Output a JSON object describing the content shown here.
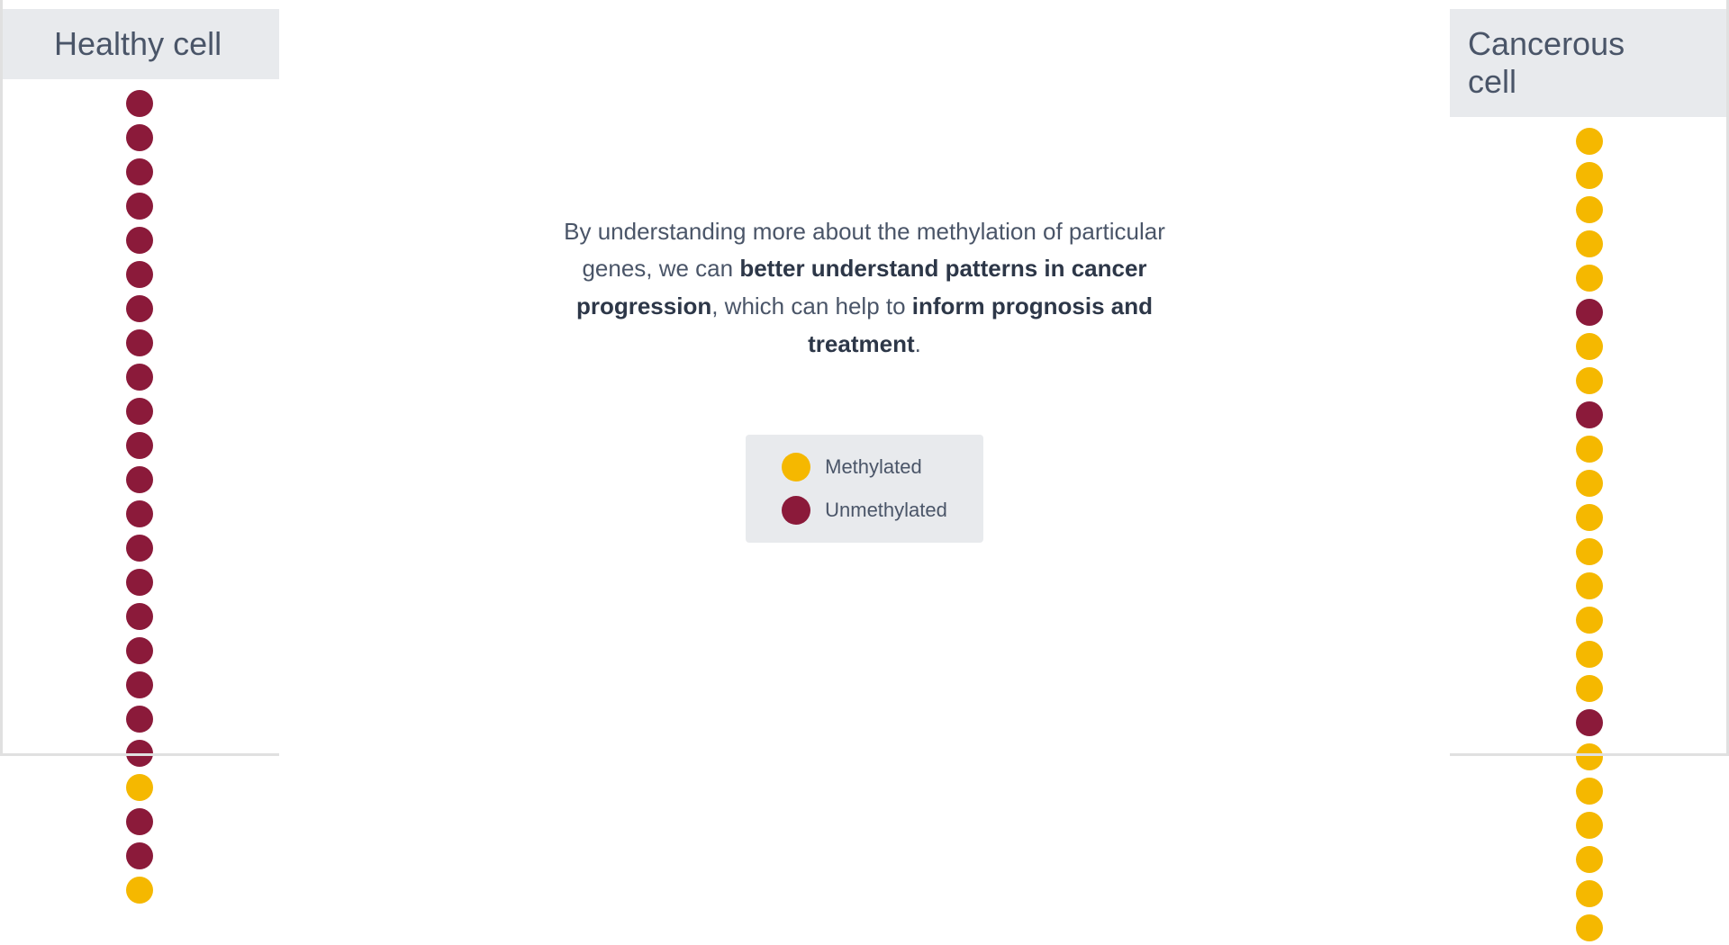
{
  "left": {
    "header": "Healthy cell",
    "dots": [
      "dark-red",
      "dark-red",
      "dark-red",
      "dark-red",
      "dark-red",
      "dark-red",
      "dark-red",
      "dark-red",
      "dark-red",
      "dark-red",
      "dark-red",
      "dark-red",
      "dark-red",
      "dark-red",
      "dark-red",
      "dark-red",
      "dark-red",
      "dark-red",
      "dark-red",
      "dark-red",
      "yellow",
      "dark-red",
      "dark-red",
      "yellow"
    ]
  },
  "right": {
    "header": "Cancerous cell",
    "dots": [
      "yellow",
      "yellow",
      "yellow",
      "yellow",
      "yellow",
      "dark-red",
      "yellow",
      "yellow",
      "dark-red",
      "yellow",
      "yellow",
      "yellow",
      "yellow",
      "yellow",
      "yellow",
      "yellow",
      "yellow",
      "dark-red",
      "yellow",
      "yellow",
      "yellow",
      "yellow",
      "yellow",
      "yellow"
    ]
  },
  "center": {
    "text_part1": "By understanding more about the methylation of particular genes, we can ",
    "text_bold1": "better understand patterns in cancer progression",
    "text_part2": ", which can help to ",
    "text_bold2": "inform prognosis and treatment",
    "text_end": "."
  },
  "legend": {
    "methylated_label": "Methylated",
    "unmethylated_label": "Unmethylated",
    "methylated_color": "#F5B800",
    "unmethylated_color": "#8B1A3A"
  }
}
